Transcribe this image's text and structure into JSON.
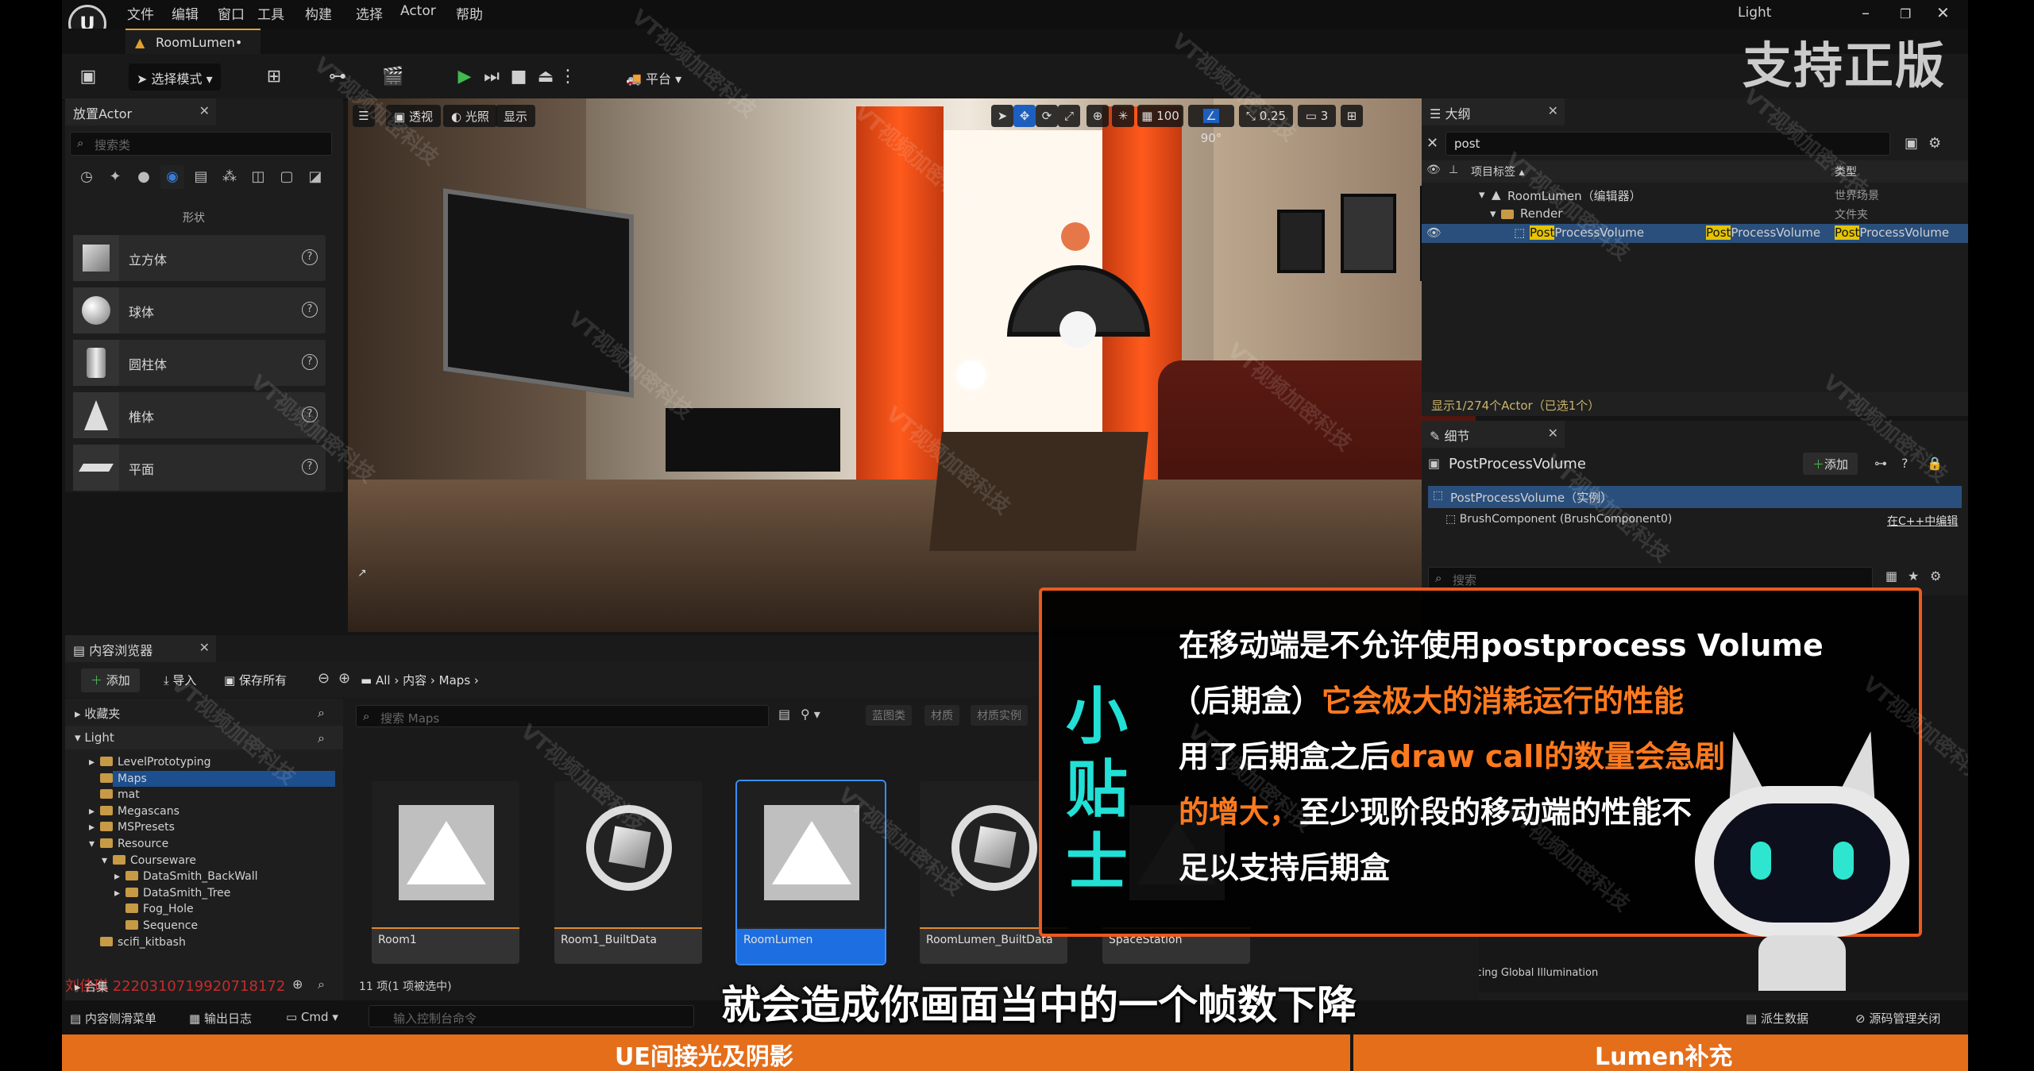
{
  "menu": {
    "logo": "U",
    "items": [
      "文件",
      "编辑",
      "窗口",
      "工具",
      "构建",
      "选择",
      "Actor",
      "帮助"
    ],
    "window_title": "Light",
    "doc_tab": "RoomLumen•"
  },
  "toolbar": {
    "select_mode": "选择模式",
    "platform": "平台"
  },
  "banner": {
    "top_right": "支持正版"
  },
  "place_actors": {
    "tab": "放置Actor",
    "search_placeholder": "搜索类",
    "category": "形状",
    "shapes": [
      "立方体",
      "球体",
      "圆柱体",
      "椎体",
      "平面"
    ]
  },
  "viewport": {
    "buttons": [
      "透视",
      "光照",
      "显示"
    ],
    "grid": "100",
    "angle": "90°",
    "scale": "0.25",
    "camera": "3"
  },
  "outliner": {
    "tab": "大纲",
    "search_value": "post",
    "col_label": "项目标签",
    "col_type": "类型",
    "rows": [
      {
        "label": "RoomLumen（编辑器）",
        "type": "世界场景"
      },
      {
        "label": "Render",
        "type": "文件夹"
      },
      {
        "label_hl": "Post",
        "label_rest": "ProcessVolume",
        "type_hl": "Post",
        "type_rest": "ProcessVolume",
        "type2_hl": "Post",
        "type2_rest": "ProcessVolume"
      }
    ],
    "count": "显示1/274个Actor（已选1个）"
  },
  "details": {
    "tab": "细节",
    "title": "PostProcessVolume",
    "add_btn": "添加",
    "instance": "PostProcessVolume（实例）",
    "component": "BrushComponent (BrushComponent0)",
    "edit_cpp": "在C++中编辑",
    "search_placeholder": "搜索",
    "rt_gi": "Ray Tracing Global Illumination",
    "source_ctrl": "源码管理关闭",
    "derived": "派生数据"
  },
  "content_browser": {
    "tab": "内容浏览器",
    "add": "添加",
    "import": "导入",
    "save_all": "保存所有",
    "path": [
      "All",
      "内容",
      "Maps"
    ],
    "favorites": "收藏夹",
    "root": "Light",
    "tree": [
      "LevelPrototyping",
      "Maps",
      "mat",
      "Megascans",
      "MSPresets",
      "Resource",
      "Courseware",
      "DataSmith_BackWall",
      "DataSmith_Tree",
      "Fog_Hole",
      "Sequence",
      "scifi_kitbash"
    ],
    "collections": "合集",
    "search_placeholder": "搜索 Maps",
    "filters": [
      "蓝图类",
      "材质",
      "材质实例"
    ],
    "assets": [
      "Room1",
      "Room1_BuiltData",
      "RoomLumen",
      "RoomLumen_BuiltData",
      "SpaceStation"
    ],
    "item_count": "11 项(1 项被选中)",
    "watermark_line": "刘佳琪 2220310719920718172"
  },
  "status": {
    "drawer": "内容侧滑菜单",
    "log": "输出日志",
    "cmd": "Cmd",
    "console_placeholder": "输入控制台命令"
  },
  "tip": {
    "badge": [
      "小",
      "贴",
      "士"
    ],
    "lines": [
      {
        "w": "在移动端是不允许使用postprocess Volume",
        "o": ""
      },
      {
        "w": "（后期盒）",
        "o": "它会极大的消耗运行的性能"
      },
      {
        "w": "用了后期盒之后",
        "o": "draw call的数量会急剧"
      },
      {
        "o": "的增大，",
        "w": "至少现阶段的移动端的性能不"
      },
      {
        "w": "足以支持后期盒",
        "o": ""
      }
    ]
  },
  "subtitle": "就会造成你画面当中的一个帧数下降",
  "bottom_band": {
    "left": "UE间接光及阴影",
    "right": "Lumen补充"
  },
  "watermark": "VT视频加密科技"
}
